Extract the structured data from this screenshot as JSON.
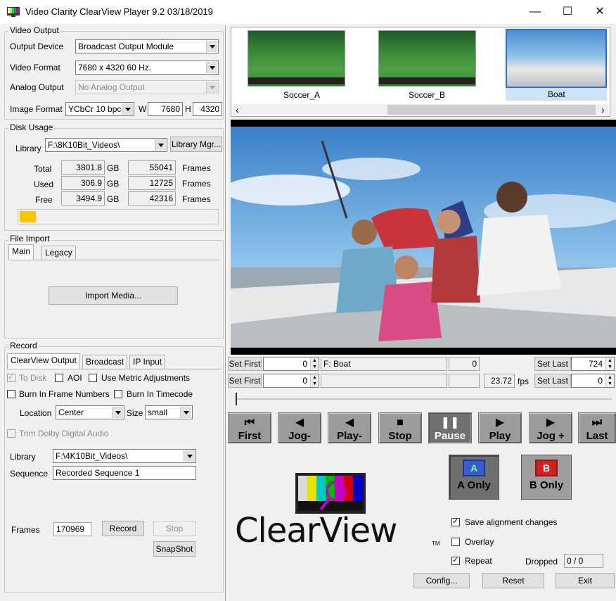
{
  "window": {
    "title": "Video Clarity ClearView Player 9.2 03/18/2019",
    "minimize": "—",
    "maximize": "☐",
    "close": "✕"
  },
  "video_output": {
    "group_label": "Video Output",
    "output_device_label": "Output Device",
    "output_device_value": "Broadcast Output Module",
    "video_format_label": "Video Format",
    "video_format_value": "7680 x 4320 60 Hz.",
    "analog_output_label": "Analog Output",
    "analog_output_value": "No Analog Output",
    "image_format_label": "Image Format",
    "image_format_value": "YCbCr 10 bpc",
    "w_label": "W",
    "w_value": "7680",
    "h_label": "H",
    "h_value": "4320"
  },
  "disk_usage": {
    "group_label": "Disk Usage",
    "library_label": "Library",
    "library_value": "F:\\8K10Bit_Videos\\",
    "library_mgr_button": "Library Mgr...",
    "rows": [
      {
        "label": "Total",
        "gb": "3801.8",
        "unit": "GB",
        "frames": "55041",
        "frames_label": "Frames"
      },
      {
        "label": "Used",
        "gb": "306.9",
        "unit": "GB",
        "frames": "12725",
        "frames_label": "Frames"
      },
      {
        "label": "Free",
        "gb": "3494.9",
        "unit": "GB",
        "frames": "42316",
        "frames_label": "Frames"
      }
    ],
    "usage_fraction": 0.08,
    "usage_color": "#ffc400"
  },
  "file_import": {
    "group_label": "File Import",
    "tabs": [
      "Main",
      "Legacy"
    ],
    "import_button": "Import Media..."
  },
  "record": {
    "group_label": "Record",
    "tabs": [
      "ClearView Output",
      "Broadcast",
      "IP Input"
    ],
    "to_disk": "To Disk",
    "aoi": "AOI",
    "use_metric": "Use Metric Adjustments",
    "burn_frame": "Burn In Frame Numbers",
    "burn_timecode": "Burn In Timecode",
    "location_label": "Location",
    "location_value": "Center",
    "size_label": "Size",
    "size_value": "small",
    "trim_dolby": "Trim Dolby Digital Audio",
    "library_label": "Library",
    "library_value": "F:\\4K10Bit_Videos\\",
    "sequence_label": "Sequence",
    "sequence_value": "Recorded Sequence 1",
    "frames_label": "Frames",
    "frames_value": "170969",
    "record_button": "Record",
    "stop_button": "Stop",
    "snapshot_button": "SnapShot"
  },
  "thumbnails": [
    {
      "name": "Soccer_A",
      "selected": false
    },
    {
      "name": "Soccer_B",
      "selected": false
    },
    {
      "name": "Boat",
      "selected": true
    }
  ],
  "scroll": {
    "left_arrow": "‹",
    "right_arrow": "›"
  },
  "timeline": {
    "set_first": "Set First",
    "first_a": "0",
    "clip_a": "F: Boat",
    "frame_a": "0",
    "set_last": "Set Last",
    "last_a": "724",
    "first_b": "0",
    "clip_b": "",
    "frame_b": "",
    "fps": "23.72",
    "fps_label": "fps",
    "last_b": "0"
  },
  "transport": [
    {
      "label": "First",
      "icon": "⏮"
    },
    {
      "label": "Jog-",
      "icon": "◀"
    },
    {
      "label": "Play-",
      "icon": "◀"
    },
    {
      "label": "Stop",
      "icon": "■"
    },
    {
      "label": "Pause",
      "icon": "❚❚"
    },
    {
      "label": "Play",
      "icon": "▶"
    },
    {
      "label": "Jog +",
      "icon": "▶"
    },
    {
      "label": "Last",
      "icon": "⏭"
    }
  ],
  "ab": {
    "a_letter": "A",
    "a_label": "A Only",
    "a_color": "#2a8a2a",
    "b_letter": "B",
    "b_label": "B Only",
    "b_color": "#d42020"
  },
  "logo": {
    "text": "ClearView",
    "tm": "TM"
  },
  "options": {
    "save_alignment": "Save alignment changes",
    "overlay": "Overlay",
    "repeat": "Repeat",
    "dropped_label": "Dropped",
    "dropped_value": "0 / 0"
  },
  "footer": {
    "config": "Config...",
    "reset": "Reset",
    "exit": "Exit"
  }
}
